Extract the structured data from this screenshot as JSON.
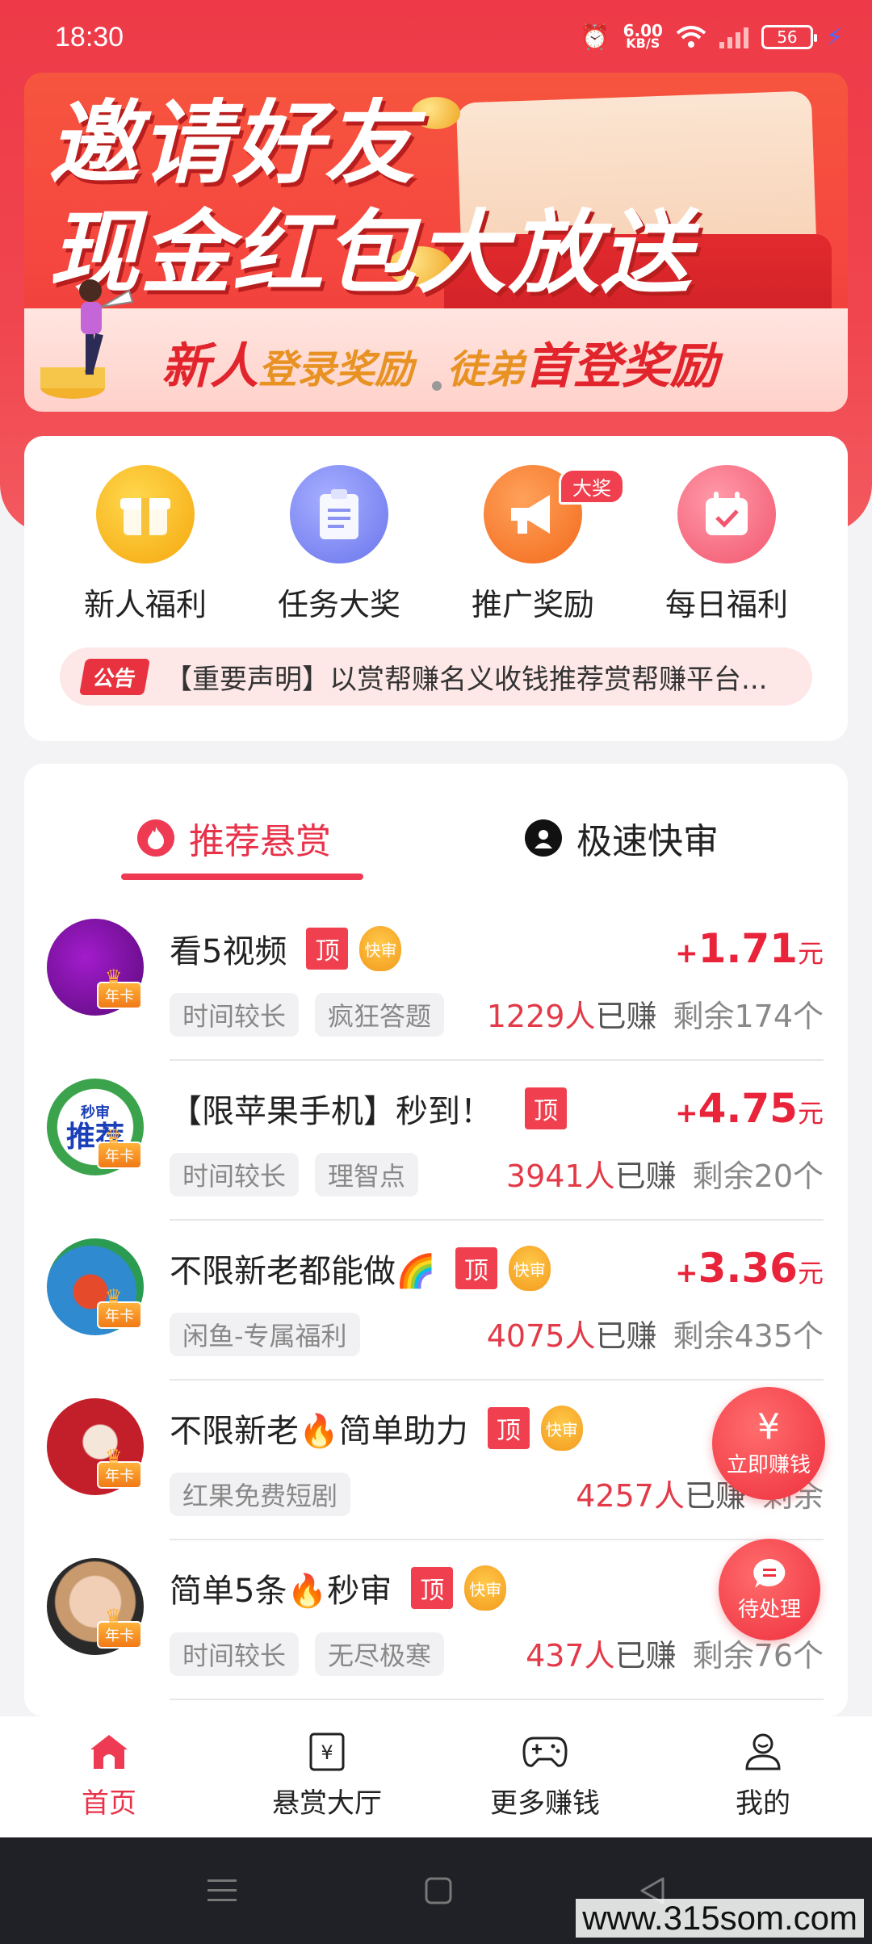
{
  "status_bar": {
    "time": "18:30",
    "net_speed": "6.00",
    "net_unit": "KB/S",
    "battery": "56"
  },
  "banner": {
    "title_line1": "邀请好友",
    "title_line2": "现金红包大放送",
    "sub_new": "新人",
    "sub_login": "登录奖励",
    "sub_disciple": "徒弟",
    "sub_first": "首登奖励"
  },
  "quick_entries": [
    {
      "label": "新人福利",
      "icon": "gift-box-icon",
      "color": "#f8b51e"
    },
    {
      "label": "任务大奖",
      "icon": "clipboard-icon",
      "color": "#7b86f3"
    },
    {
      "label": "推广奖励",
      "icon": "megaphone-icon",
      "color": "#f77a2a",
      "badge": "大奖"
    },
    {
      "label": "每日福利",
      "icon": "calendar-check-icon",
      "color": "#f5647a"
    }
  ],
  "notice": {
    "tag": "公告",
    "text": "【重要声明】以赏帮赚名义收钱推荐赏帮赚平台..."
  },
  "tabs": {
    "recommended": "推荐悬赏",
    "fast_review": "极速快审"
  },
  "badges": {
    "top": "顶",
    "fast": "快审",
    "year_card": "年卡"
  },
  "tasks": [
    {
      "title": "看5视频",
      "has_fast": true,
      "reward": "1.71",
      "tags": [
        "时间较长",
        "疯狂答题"
      ],
      "earned_count": "1229人",
      "remaining": "剩余174个"
    },
    {
      "title": "【限苹果手机】秒到！",
      "has_fast": false,
      "reward": "4.75",
      "tags": [
        "时间较长",
        "理智点"
      ],
      "earned_count": "3941人",
      "remaining": "剩余20个"
    },
    {
      "title": "不限新老都能做🌈",
      "has_fast": true,
      "reward": "3.36",
      "tags": [
        "闲鱼-专属福利"
      ],
      "earned_count": "4075人",
      "remaining": "剩余435个"
    },
    {
      "title": "不限新老🔥简单助力",
      "has_fast": true,
      "reward": "",
      "tags": [
        "红果免费短剧"
      ],
      "earned_count": "4257人",
      "remaining": "剩余"
    },
    {
      "title": "简单5条🔥秒审",
      "has_fast": true,
      "reward": "",
      "tags": [
        "时间较长",
        "无尽极寒"
      ],
      "earned_count": "437人",
      "remaining": "剩余76个"
    }
  ],
  "reward_plus": "+",
  "reward_unit": "元",
  "earned_suffix": "已赚",
  "avatar_texts": {
    "tag": "秒审",
    "main": "推荐"
  },
  "floating": {
    "earn_now": "立即赚钱",
    "earn_symbol": "¥",
    "pending": "待处理"
  },
  "bottom_nav": [
    {
      "label": "首页",
      "icon": "home-icon",
      "active": true
    },
    {
      "label": "悬赏大厅",
      "icon": "yuan-doc-icon",
      "active": false
    },
    {
      "label": "更多赚钱",
      "icon": "gamepad-icon",
      "active": false
    },
    {
      "label": "我的",
      "icon": "user-icon",
      "active": false
    }
  ],
  "watermark": "www.315som.com",
  "colors": {
    "brand_red": "#ee3a48",
    "reward_red": "#e8233a",
    "tab_active": "#e8324a"
  }
}
